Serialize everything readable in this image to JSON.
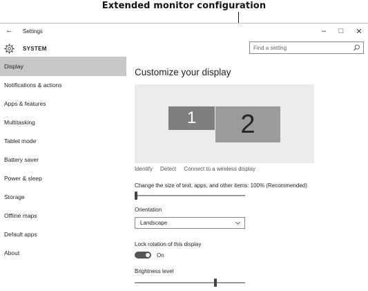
{
  "callout": {
    "text": "Extended monitor configuration"
  },
  "window": {
    "back_icon": "back-arrow-icon",
    "title": "Settings",
    "controls": {
      "minimize": "–",
      "maximize": "□",
      "close": "✕"
    }
  },
  "section": {
    "icon": "gear-icon",
    "title": "SYSTEM"
  },
  "search": {
    "placeholder": "Find a setting",
    "icon": "search-icon"
  },
  "sidebar": {
    "items": [
      {
        "label": "Display",
        "active": true
      },
      {
        "label": "Notifications & actions",
        "active": false
      },
      {
        "label": "Apps & features",
        "active": false
      },
      {
        "label": "Multitasking",
        "active": false
      },
      {
        "label": "Tablet mode",
        "active": false
      },
      {
        "label": "Battery saver",
        "active": false
      },
      {
        "label": "Power & sleep",
        "active": false
      },
      {
        "label": "Storage",
        "active": false
      },
      {
        "label": "Offline maps",
        "active": false
      },
      {
        "label": "Default apps",
        "active": false
      },
      {
        "label": "About",
        "active": false
      }
    ]
  },
  "main": {
    "heading": "Customize your display",
    "monitors": [
      {
        "label": "1"
      },
      {
        "label": "2"
      }
    ],
    "links": {
      "identify": "Identify",
      "detect": "Detect",
      "wireless": "Connect to a wireless display"
    },
    "scale": {
      "label": "Change the size of text, apps, and other items: 100% (Recommended)",
      "value_fraction": 0.0
    },
    "orientation": {
      "label": "Orientation",
      "value": "Landscape"
    },
    "lock_rotation": {
      "label": "Lock rotation of this display",
      "state_label": "On",
      "on": true
    },
    "brightness": {
      "label": "Brightness level",
      "value_fraction": 0.74
    }
  },
  "colors": {
    "active_nav": "#c7c7c7",
    "display_area": "#ebebeb",
    "monitor_1": "#7e7e7e",
    "monitor_2": "#9b9b9b",
    "toggle_on": "#555555"
  }
}
